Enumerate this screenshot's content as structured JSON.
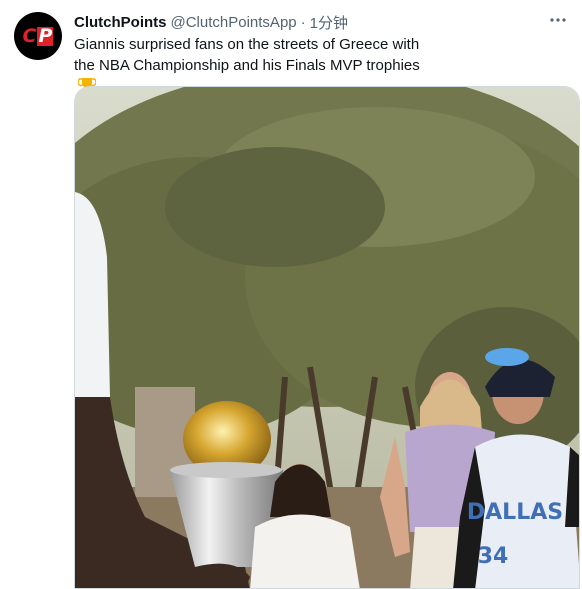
{
  "tweet": {
    "author": {
      "display_name": "ClutchPoints",
      "handle": "@ClutchPointsApp",
      "avatar_text": "CP"
    },
    "separator": "·",
    "timestamp": "1分钟",
    "text": "Giannis surprised fans on the streets of Greece with the NBA Championship and his Finals MVP trophies",
    "emoji": "trophy-emoji",
    "more_icon": "more-icon",
    "media": {
      "kind": "video-frame",
      "jersey_text": "DALLAS",
      "jersey_number": "34"
    }
  },
  "colors": {
    "text": "#0f1419",
    "secondary_text": "#536471",
    "brand_red": "#e0202b"
  }
}
